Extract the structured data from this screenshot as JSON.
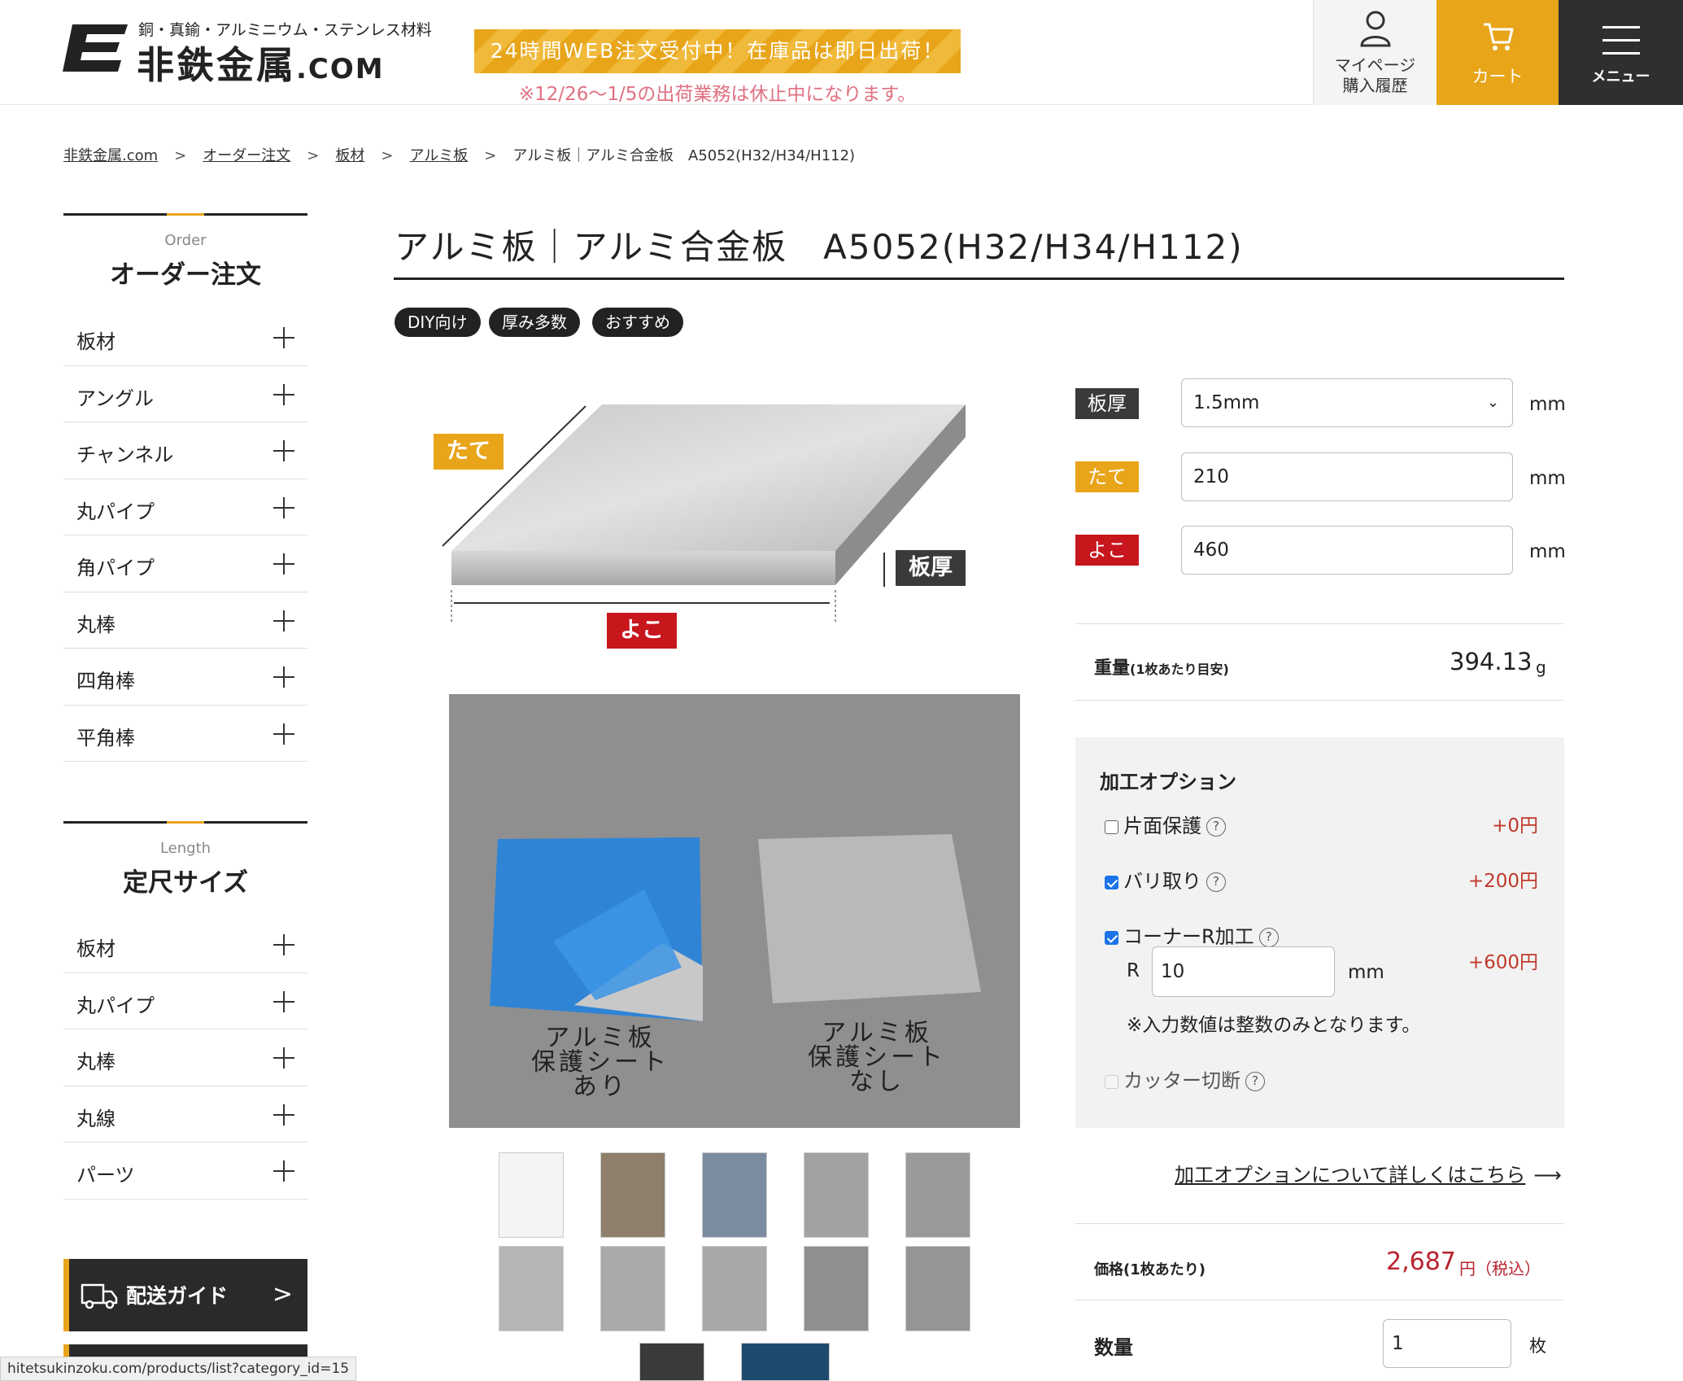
{
  "header": {
    "logo_sub": "銅・真鍮・アルミニウム・ステンレス材料",
    "logo_name": "非鉄金属",
    "logo_com": ".COM",
    "banner": "24時間WEB注文受付中！在庫品は即日出荷！",
    "notice": "※12/26〜1/5の出荷業務は休止中になります。",
    "mypage_line1": "マイページ",
    "mypage_line2": "購入履歴",
    "cart": "カート",
    "menu": "メニュー",
    "accent_color": "#e8a51a"
  },
  "breadcrumb": [
    "非鉄金属.com",
    "オーダー注文",
    "板材",
    "アルミ板",
    "アルミ板｜アルミ合金板　A5052(H32/H34/H112)"
  ],
  "sidebar": {
    "order": {
      "en": "Order",
      "title": "オーダー注文",
      "items": [
        "板材",
        "アングル",
        "チャンネル",
        "丸パイプ",
        "角パイプ",
        "丸棒",
        "四角棒",
        "平角棒"
      ]
    },
    "length": {
      "en": "Length",
      "title": "定尺サイズ",
      "items": [
        "板材",
        "丸パイプ",
        "丸棒",
        "丸線",
        "パーツ"
      ]
    },
    "shipping_guide": "配送ガイド"
  },
  "status_url": "hitetsukinzoku.com/products/list?category_id=15",
  "product": {
    "title": "アルミ板｜アルミ合金板　A5052(H32/H34/H112)",
    "tags": [
      "DIY向け",
      "厚み多数",
      "おすすめ"
    ],
    "diagram": {
      "tate": "たて",
      "yoko": "よこ",
      "itaatsu": "板厚"
    },
    "photo": {
      "left_caption": [
        "アルミ板",
        "保護シート",
        "あり"
      ],
      "right_caption": [
        "アルミ板",
        "保護シート",
        "なし"
      ]
    },
    "thumbnail_count": 12
  },
  "form": {
    "thickness": {
      "label": "板厚",
      "value": "1.5mm",
      "unit": "mm",
      "color": "#3a3a3a"
    },
    "tate": {
      "label": "たて",
      "value": "210",
      "unit": "mm",
      "color": "#e8a51a"
    },
    "yoko": {
      "label": "よこ",
      "value": "460",
      "unit": "mm",
      "color": "#c8161d"
    },
    "weight_label": "重量",
    "weight_note": "(1枚あたり目安)",
    "weight_value": "394.13",
    "weight_unit": "g"
  },
  "options": {
    "title": "加工オプション",
    "items": [
      {
        "label": "片面保護",
        "price": "+0円",
        "checked": false
      },
      {
        "label": "バリ取り",
        "price": "+200円",
        "checked": true
      },
      {
        "label": "コーナーR加工",
        "price": "+600円",
        "checked": true
      },
      {
        "label": "カッター切断",
        "price": "",
        "checked": false,
        "disabled": true
      }
    ],
    "r_label": "R",
    "r_value": "10",
    "r_unit": "mm",
    "note": "※入力数値は整数のみとなります。",
    "link": "加工オプションについて詳しくはこちら"
  },
  "price": {
    "label": "価格(1枚あたり)",
    "value": "2,687",
    "unit": "円（税込）"
  },
  "quantity": {
    "label": "数量",
    "value": "1",
    "unit": "枚"
  }
}
